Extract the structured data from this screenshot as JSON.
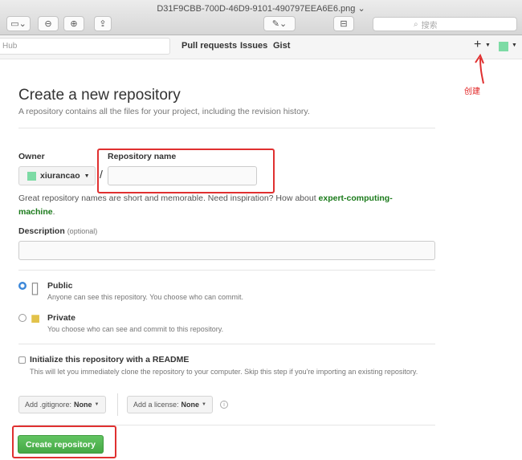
{
  "window": {
    "title": "D31F9CBB-700D-46D9-9101-490797EEA6E6.png",
    "search_placeholder": "搜索"
  },
  "header": {
    "search_partial": "Hub",
    "nav": [
      "Pull requests",
      "Issues",
      "Gist"
    ],
    "plus": "+",
    "annotation": "创建"
  },
  "page": {
    "title": "Create a new repository",
    "subtitle": "A repository contains all the files for your project, including the revision history.",
    "owner_label": "Owner",
    "owner_value": "xiurancao",
    "slash": "/",
    "repo_label": "Repository name",
    "repo_value": "",
    "hint_text": "Great repository names are short and memorable. Need inspiration? How about",
    "hint_suggestion": "expert-computing-machine",
    "hint_period": ".",
    "description_label": "Description",
    "description_optional": "(optional)",
    "description_value": "",
    "visibility": {
      "selected": "public",
      "public_title": "Public",
      "public_desc": "Anyone can see this repository. You choose who can commit.",
      "private_title": "Private",
      "private_desc": "You choose who can see and commit to this repository."
    },
    "readme": {
      "checked": false,
      "title": "Initialize this repository with a README",
      "desc": "This will let you immediately clone the repository to your computer. Skip this step if you're importing an existing repository."
    },
    "gitignore_label": "Add .gitignore:",
    "gitignore_value": "None",
    "license_label": "Add a license:",
    "license_value": "None",
    "info": "i",
    "submit_label": "Create repository"
  },
  "colors": {
    "annotation_red": "#e03030",
    "primary_green": "#4cae4c",
    "suggestion_green": "#1a7a1a",
    "radio_blue": "#3b87d9"
  }
}
